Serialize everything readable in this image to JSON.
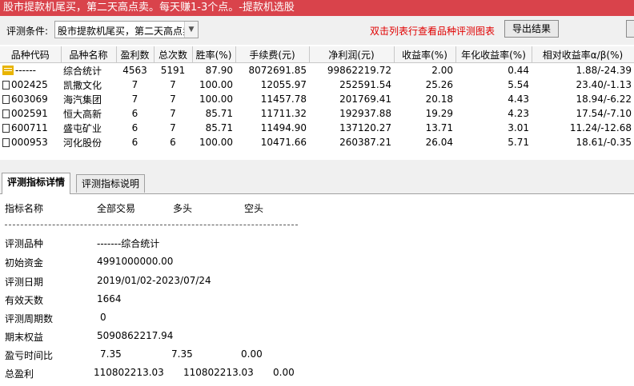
{
  "title": "股市提款机尾买，第二天高点卖。每天赚1-3个点。-提款机选股",
  "toolbar": {
    "condition_label": "评测条件:",
    "condition_value": "股市提款机尾买，第二天高点卖",
    "hint": "双击列表行查看品种评测图表",
    "export_label": "导出结果"
  },
  "table": {
    "headers": [
      "品种代码",
      "品种名称",
      "盈利数",
      "总次数",
      "胜率(%)",
      "手续费(元)",
      "净利润(元)",
      "收益率(%)",
      "年化收益率(%)",
      "相对收益率α/β(%)"
    ],
    "rows": [
      {
        "icon": "summary",
        "code": "------",
        "name": "综合统计",
        "wins": "4563",
        "total": "5191",
        "rate": "87.90",
        "fee": "8072691.85",
        "profit": "99862219.72",
        "ret": "2.00",
        "annual": "0.44",
        "rel": "1.88/-24.39"
      },
      {
        "icon": "item",
        "code": "002425",
        "name": "凯撒文化",
        "wins": "7",
        "total": "7",
        "rate": "100.00",
        "fee": "12055.97",
        "profit": "252591.54",
        "ret": "25.26",
        "annual": "5.54",
        "rel": "23.40/-1.13"
      },
      {
        "icon": "item",
        "code": "603069",
        "name": "海汽集团",
        "wins": "7",
        "total": "7",
        "rate": "100.00",
        "fee": "11457.78",
        "profit": "201769.41",
        "ret": "20.18",
        "annual": "4.43",
        "rel": "18.94/-6.22"
      },
      {
        "icon": "item",
        "code": "002591",
        "name": "恒大高新",
        "wins": "6",
        "total": "7",
        "rate": "85.71",
        "fee": "11711.32",
        "profit": "192937.88",
        "ret": "19.29",
        "annual": "4.23",
        "rel": "17.54/-7.10"
      },
      {
        "icon": "item",
        "code": "600711",
        "name": "盛屯矿业",
        "wins": "6",
        "total": "7",
        "rate": "85.71",
        "fee": "11494.90",
        "profit": "137120.27",
        "ret": "13.71",
        "annual": "3.01",
        "rel": "11.24/-12.68"
      },
      {
        "icon": "item",
        "code": "000953",
        "name": "河化股份",
        "wins": "6",
        "total": "6",
        "rate": "100.00",
        "fee": "10471.66",
        "profit": "260387.21",
        "ret": "26.04",
        "annual": "5.71",
        "rel": "18.61/-0.35"
      }
    ]
  },
  "tabs": [
    {
      "label": "评测指标详情",
      "active": true
    },
    {
      "label": "评测指标说明",
      "active": false
    }
  ],
  "detail": {
    "header": {
      "name": "指标名称",
      "all": "全部交易",
      "long": "多头",
      "short": "空头"
    },
    "rows": [
      {
        "label": "评测品种",
        "v1": "-------综合统计",
        "v2": "",
        "v3": ""
      },
      {
        "label": "初始资金",
        "v1": "4991000000.00",
        "v2": "",
        "v3": ""
      },
      {
        "label": "评测日期",
        "v1": "2019/01/02-2023/07/24",
        "v2": "",
        "v3": ""
      },
      {
        "label": "有效天数",
        "v1": "1664",
        "v2": "",
        "v3": ""
      },
      {
        "label": "评测周期数",
        "v1": "0",
        "v2": "",
        "v3": ""
      },
      {
        "label": "期末权益",
        "v1": "5090862217.94",
        "v2": "",
        "v3": ""
      },
      {
        "label": "盈亏时间比",
        "v1": "7.35",
        "v2": "7.35",
        "v3": "0.00"
      },
      {
        "label": "总盈利",
        "v1": "110802213.03",
        "v2": "110802213.03",
        "v3": "0.00"
      }
    ]
  },
  "colors": {
    "titlebar": "#d9434b",
    "hint": "#e00000",
    "summary_icon": "#e8b400"
  }
}
